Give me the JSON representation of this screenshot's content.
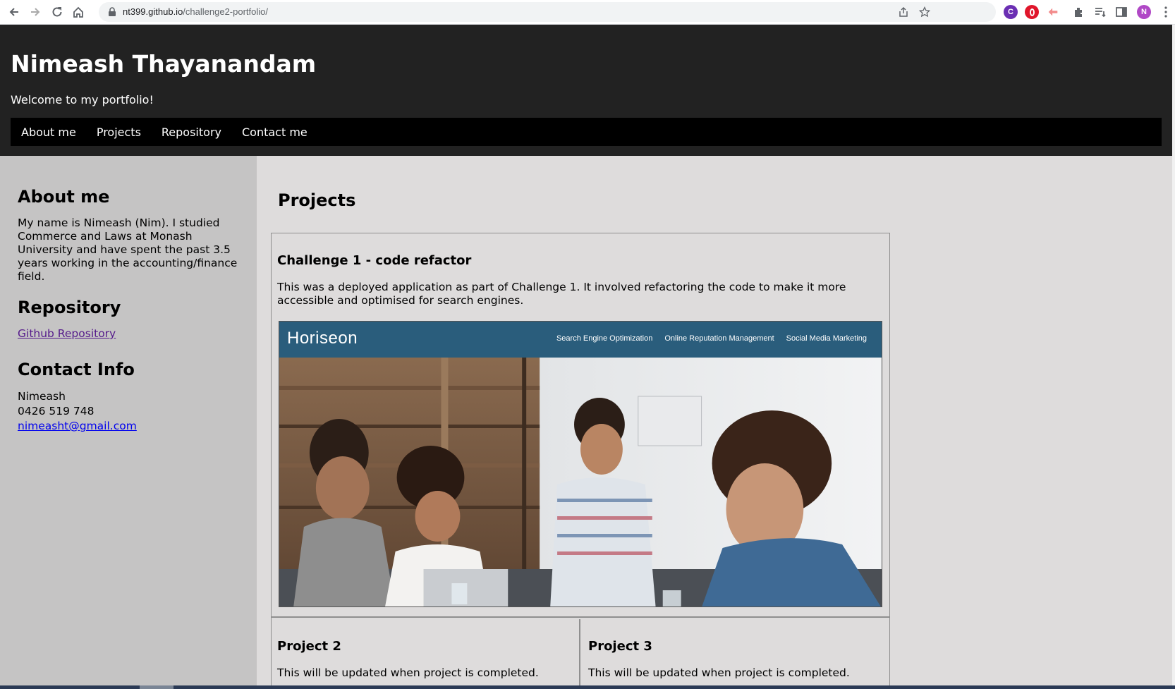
{
  "browser": {
    "url_host": "nt399.github.io",
    "url_path": "/challenge2-portfolio/",
    "nav_icons": [
      "back-arrow-icon",
      "forward-arrow-icon",
      "reload-icon",
      "home-icon"
    ],
    "extensions": [
      {
        "name": "extension-c-icon",
        "letter": "C",
        "color": "#6b2fb3"
      },
      {
        "name": "opera-icon",
        "letter": "",
        "color": "#e0162b"
      },
      {
        "name": "extension-pink-icon",
        "letter": "",
        "color": "#f28b8b"
      }
    ],
    "profile": {
      "letter": "N",
      "color": "#b048c6"
    }
  },
  "header": {
    "title": "Nimeash Thayanandam",
    "subtitle": "Welcome to my portfolio!",
    "nav": [
      "About me",
      "Projects",
      "Repository",
      "Contact me"
    ]
  },
  "sidebar": {
    "about_heading": "About me",
    "about_text": "My name is Nimeash (Nim). I studied Commerce and Laws at Monash University and have spent the past 3.5 years working in the accounting/finance field.",
    "repo_heading": "Repository",
    "repo_link": "Github Repository",
    "contact_heading": "Contact Info",
    "contact_name": "Nimeash",
    "contact_phone": "0426 519 748",
    "contact_email": "nimeasht@gmail.com"
  },
  "main": {
    "title": "Projects",
    "project1": {
      "title": "Challenge 1 - code refactor",
      "description": "This was a deployed application as part of Challenge 1. It involved refactoring the code to make it more accessible and optimised for search engines.",
      "screenshot_logo": "Horiseon",
      "screenshot_links": [
        "Search Engine Optimization",
        "Online Reputation Management",
        "Social Media Marketing"
      ]
    },
    "project2": {
      "title": "Project 2",
      "description": "This will be updated when project is completed."
    },
    "project3": {
      "title": "Project 3",
      "description": "This will be updated when project is completed."
    }
  },
  "colors": {
    "header_bg": "#222222",
    "nav_bg": "#000000",
    "sidebar_bg": "#c5c4c4",
    "main_bg": "#dedcdc",
    "horiseon_bar": "#2a5d7c"
  }
}
